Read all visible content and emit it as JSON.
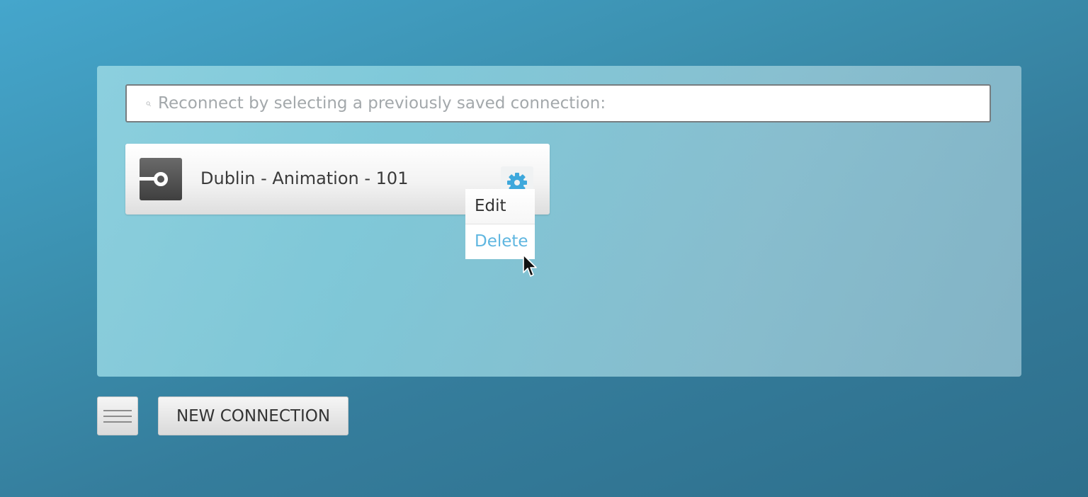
{
  "search": {
    "placeholder": "Reconnect by selecting a previously saved connection:",
    "icon": "search-icon"
  },
  "connections": [
    {
      "name": "Dublin - Animation - 101",
      "icon": "connection-icon",
      "settings_icon": "gear-icon"
    }
  ],
  "context_menu": {
    "items": [
      {
        "label": "Edit"
      },
      {
        "label": "Delete"
      }
    ],
    "hover_item": "Delete"
  },
  "footer": {
    "menu_icon": "hamburger-menu-icon",
    "new_connection_label": "NEW CONNECTION"
  },
  "colors": {
    "accent": "#5fb6e0",
    "gear": "#3ea8dc"
  }
}
